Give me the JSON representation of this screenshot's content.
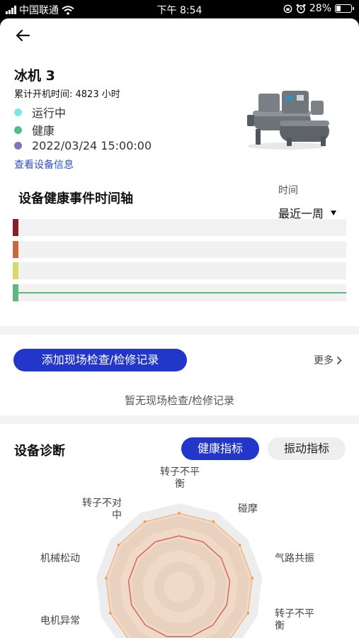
{
  "status_bar": {
    "carrier": "中国联通",
    "time": "下午 8:54",
    "battery": "28%",
    "battery_level": 0.28
  },
  "header": {
    "back_icon": "arrow-left-icon"
  },
  "device": {
    "name": "冰机 3",
    "runtime": "累计开机时间: 4823 小时",
    "statuses": [
      {
        "label": "运行中",
        "color": "#7ee7e4"
      },
      {
        "label": "健康",
        "color": "#4fbf86"
      },
      {
        "label": "2022/03/24 15:00:00",
        "color": "#7a78b8"
      }
    ],
    "info_link": "查看设备信息"
  },
  "timeline": {
    "title": "设备健康事件时间轴",
    "time_label": "时间",
    "time_value": "最近一周",
    "tracks": [
      {
        "color": "#8b1d24",
        "has_line": false
      },
      {
        "color": "#c9683a",
        "has_line": false
      },
      {
        "color": "#d8d96a",
        "has_line": false
      },
      {
        "color": "#5db87f",
        "has_line": true
      }
    ]
  },
  "inspection": {
    "add_button": "添加现场检查/检修记录",
    "more_label": "更多",
    "empty_text": "暂无现场检查/检修记录"
  },
  "diagnosis": {
    "title": "设备诊断",
    "tabs": [
      {
        "label": "健康指标",
        "active": true
      },
      {
        "label": "振动指标",
        "active": false
      }
    ],
    "radar_labels": [
      [
        "转子不平",
        "衡"
      ],
      [
        "碰摩"
      ],
      [
        "气路共振"
      ],
      [
        "转子不平",
        "衡"
      ],
      [
        "电机异常"
      ],
      [
        "机械松动"
      ],
      [
        "转子不对",
        "中"
      ]
    ]
  },
  "colors": {
    "accent": "#2237c9",
    "link": "#2c4fd1"
  }
}
